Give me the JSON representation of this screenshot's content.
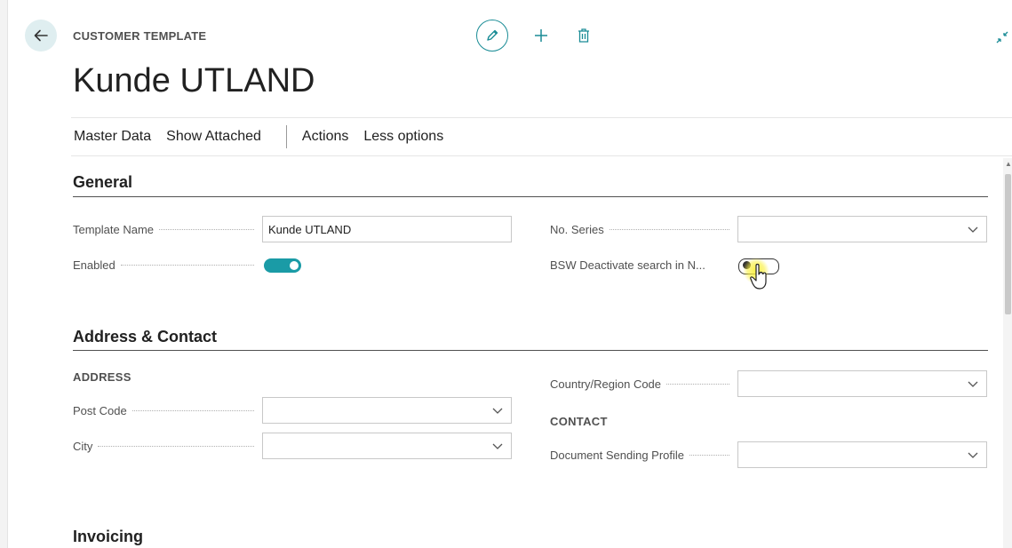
{
  "header": {
    "caption": "CUSTOMER TEMPLATE",
    "title": "Kunde UTLAND",
    "back_icon": "back-arrow-icon",
    "actions": [
      "edit-pencil-icon",
      "plus-icon",
      "delete-trash-icon"
    ],
    "collapse_icon": "collapse-icon"
  },
  "menu": {
    "items": [
      "Master Data",
      "Show Attached"
    ],
    "secondary": [
      "Actions",
      "Less options"
    ]
  },
  "sections": {
    "general": {
      "title": "General",
      "template_name_label": "Template Name",
      "template_name_value": "Kunde UTLAND",
      "enabled_label": "Enabled",
      "enabled_value": true,
      "no_series_label": "No. Series",
      "no_series_value": "",
      "bsw_label": "BSW Deactivate search in N...",
      "bsw_value": false
    },
    "address_contact": {
      "title": "Address & Contact",
      "address_subhead": "ADDRESS",
      "post_code_label": "Post Code",
      "post_code_value": "",
      "city_label": "City",
      "city_value": "",
      "country_label": "Country/Region Code",
      "country_value": "",
      "contact_subhead": "CONTACT",
      "doc_sending_label": "Document Sending Profile",
      "doc_sending_value": ""
    },
    "invoicing": {
      "title": "Invoicing"
    }
  },
  "colors": {
    "accent": "#1a9ba6",
    "back_button_bg": "#dfeef0",
    "text": "#212121",
    "label": "#505050"
  }
}
